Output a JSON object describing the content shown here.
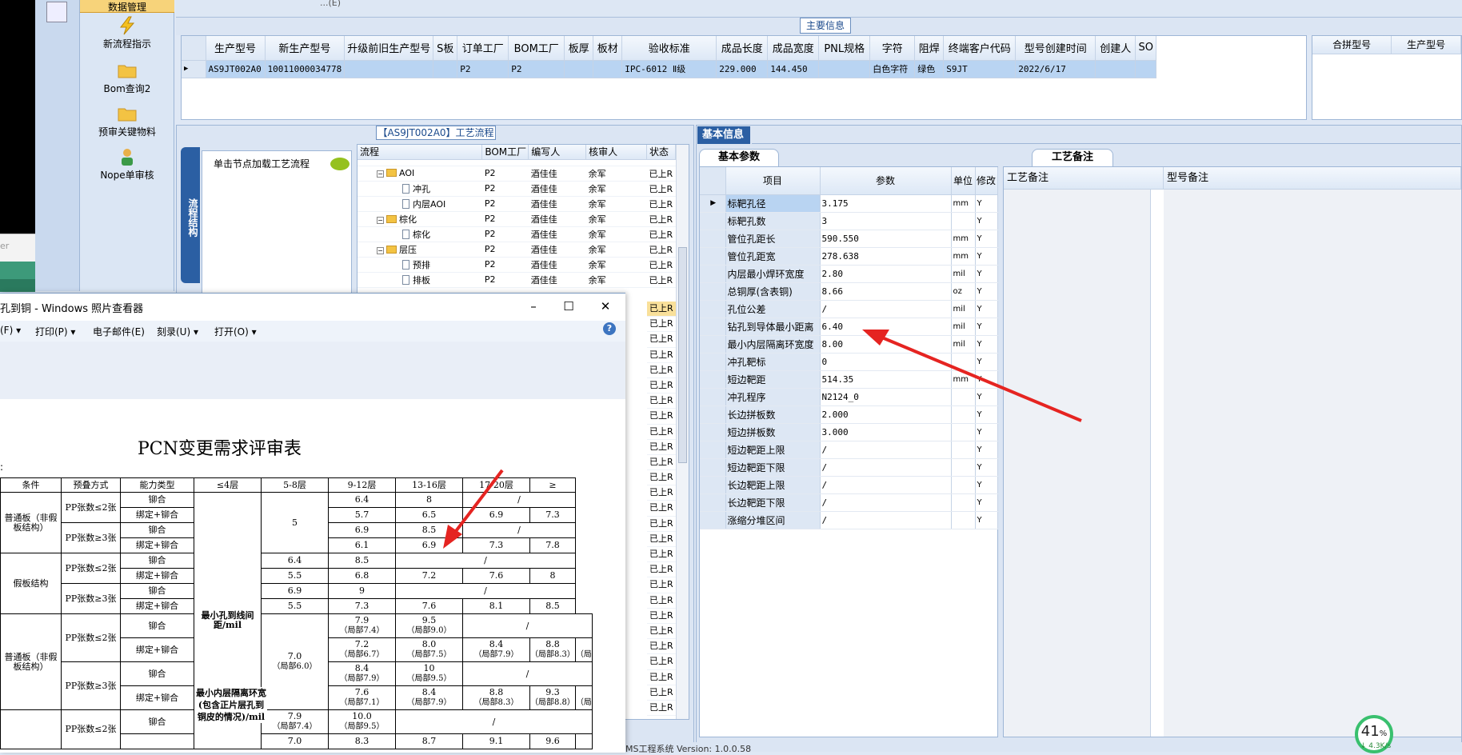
{
  "top_partial_text": "...(E)",
  "nav": {
    "header": "数据管理",
    "items": [
      {
        "label": "新流程指示"
      },
      {
        "label": "Bom查询2"
      },
      {
        "label": "预审关键物料"
      },
      {
        "label": "Nope单审核"
      }
    ]
  },
  "left_pane": {
    "placeholder": "er"
  },
  "main_info": {
    "title": "主要信息",
    "columns": [
      "生产型号",
      "新生产型号",
      "升级前旧生产型号",
      "S板",
      "订单工厂",
      "BOM工厂",
      "板厚",
      "板材",
      "验收标准",
      "成品长度",
      "成品宽度",
      "PNL规格",
      "字符",
      "阻焊",
      "终端客户代码",
      "型号创建时间",
      "创建人",
      "SO"
    ],
    "row": [
      "AS9JT002A0",
      "10011000034778",
      "",
      "",
      "P2",
      "P2",
      "",
      "",
      "IPC-6012 Ⅱ级",
      "229.000",
      "144.450",
      "",
      "白色字符",
      "绿色",
      "S9JT",
      "2022/6/17",
      "",
      ""
    ]
  },
  "right_grid": {
    "columns": [
      "合拼型号",
      "生产型号"
    ]
  },
  "process": {
    "title": "【AS9JT002A0】工艺流程",
    "vertical_tab": "流程结构",
    "hint": "单击节点加载工艺流程",
    "columns": [
      "流程",
      "BOM工厂",
      "编写人",
      "核审人",
      "状态"
    ],
    "rows": [
      {
        "name": "",
        "bom": "",
        "writer": "",
        "reviewer": "",
        "status": ""
      },
      {
        "name": "AOI",
        "bom": "P2",
        "writer": "酒佳佳",
        "reviewer": "余军",
        "status": "已上R"
      },
      {
        "name": "冲孔",
        "bom": "P2",
        "writer": "酒佳佳",
        "reviewer": "余军",
        "status": "已上R"
      },
      {
        "name": "内层AOI",
        "bom": "P2",
        "writer": "酒佳佳",
        "reviewer": "余军",
        "status": "已上R"
      },
      {
        "name": "棕化",
        "bom": "P2",
        "writer": "酒佳佳",
        "reviewer": "余军",
        "status": "已上R"
      },
      {
        "name": "棕化",
        "bom": "P2",
        "writer": "酒佳佳",
        "reviewer": "余军",
        "status": "已上R"
      },
      {
        "name": "层压",
        "bom": "P2",
        "writer": "酒佳佳",
        "reviewer": "余军",
        "status": "已上R"
      },
      {
        "name": "预排",
        "bom": "P2",
        "writer": "酒佳佳",
        "reviewer": "余军",
        "status": "已上R"
      },
      {
        "name": "排板",
        "bom": "P2",
        "writer": "酒佳佳",
        "reviewer": "余军",
        "status": "已上R"
      }
    ],
    "status_tail": "已上R"
  },
  "basic": {
    "tab": "基本信息",
    "param_tab": "基本参数",
    "remark_tab": "工艺备注",
    "param_columns": [
      "项目",
      "参数",
      "单位",
      "修改"
    ],
    "params": [
      {
        "item": "标靶孔径",
        "value": "3.175",
        "unit": "mm",
        "mod": "Y"
      },
      {
        "item": "标靶孔数",
        "value": "3",
        "unit": "",
        "mod": "Y"
      },
      {
        "item": "管位孔距长",
        "value": "590.550",
        "unit": "mm",
        "mod": "Y"
      },
      {
        "item": "管位孔距宽",
        "value": "278.638",
        "unit": "mm",
        "mod": "Y"
      },
      {
        "item": "内层最小焊环宽度",
        "value": "2.80",
        "unit": "mil",
        "mod": "Y"
      },
      {
        "item": "总铜厚(含表铜)",
        "value": "8.66",
        "unit": "oz",
        "mod": "Y"
      },
      {
        "item": "孔位公差",
        "value": "/",
        "unit": "mil",
        "mod": "Y"
      },
      {
        "item": "钻孔到导体最小距离",
        "value": "6.40",
        "unit": "mil",
        "mod": "Y"
      },
      {
        "item": "最小内层隔离环宽度",
        "value": "8.00",
        "unit": "mil",
        "mod": "Y"
      },
      {
        "item": "冲孔靶标",
        "value": "0",
        "unit": "",
        "mod": "Y"
      },
      {
        "item": "短边靶距",
        "value": "514.35",
        "unit": "mm",
        "mod": "Y"
      },
      {
        "item": "冲孔程序",
        "value": "N2124_0",
        "unit": "",
        "mod": "Y"
      },
      {
        "item": "长边拼板数",
        "value": "2.000",
        "unit": "",
        "mod": "Y"
      },
      {
        "item": "短边拼板数",
        "value": "3.000",
        "unit": "",
        "mod": "Y"
      },
      {
        "item": "短边靶距上限",
        "value": "/",
        "unit": "",
        "mod": "Y"
      },
      {
        "item": "短边靶距下限",
        "value": "/",
        "unit": "",
        "mod": "Y"
      },
      {
        "item": "长边靶距上限",
        "value": "/",
        "unit": "",
        "mod": "Y"
      },
      {
        "item": "长边靶距下限",
        "value": "/",
        "unit": "",
        "mod": "Y"
      },
      {
        "item": "涨缩分堆区间",
        "value": "/",
        "unit": "",
        "mod": "Y"
      }
    ],
    "remark_columns": [
      "工艺备注",
      "型号备注"
    ]
  },
  "status_bar": "MS工程系统  Version: 1.0.0.58",
  "net_widget": {
    "percent": "41",
    "unit": "%",
    "speed": "↓ 4.3K/s"
  },
  "viewer": {
    "title": "孔到铜 - Windows 照片查看器",
    "menu": [
      "(F) ▾",
      "打印(P) ▾",
      "电子邮件(E)",
      "刻录(U) ▾",
      "打开(O) ▾"
    ],
    "help": "?",
    "doc_title": "PCN变更需求评审表",
    "doc_colon": ":",
    "table": {
      "headers": [
        "条件",
        "预叠方式",
        "能力类型",
        "≤4层",
        "5-8层",
        "9-12层",
        "13-16层",
        "17-20层",
        "≥"
      ],
      "groups": {
        "normal": "普通板（非假板结构）",
        "fake": "假板结构",
        "pp_le2": "PP张数≤2张",
        "pp_ge3": "PP张数≥3张"
      },
      "stack": {
        "rivet": "铆合",
        "bind_rivet": "绑定+铆合"
      },
      "ability1": "最小孔到线间距/mil",
      "ability2": "最小内层隔离环宽(包含正片层孔到铜皮的情况)/mil",
      "r1": [
        "6.4",
        "8",
        "/"
      ],
      "r2": [
        "5.7",
        "6.5",
        "6.9",
        "7.3"
      ],
      "r3": [
        "6.9",
        "8.5",
        "/"
      ],
      "r4": [
        "6.1",
        "6.9",
        "7.3",
        "7.8"
      ],
      "le4_top": "5",
      "r5": [
        "6.4",
        "8.5",
        "/"
      ],
      "r6": [
        "5.5",
        "6.8",
        "7.2",
        "7.6",
        "8"
      ],
      "r7": [
        "6.9",
        "9",
        "/"
      ],
      "r8": [
        "5.5",
        "7.3",
        "7.6",
        "8.1",
        "8.5"
      ],
      "r9": [
        "7.9",
        "（局部7.4）",
        "9.5",
        "（局部9.0）",
        "/"
      ],
      "r10": [
        "7.2",
        "（局部6.7）",
        "8.0",
        "（局部7.5）",
        "8.4",
        "（局部7.9）",
        "8.8",
        "（局部8.3）",
        "（局"
      ],
      "le4_mid": "7.0",
      "le4_mid_sub": "（局部6.0）",
      "r11": [
        "8.4",
        "（局部7.9）",
        "10",
        "（局部9.5）",
        "/"
      ],
      "r12": [
        "7.6",
        "（局部7.1）",
        "8.4",
        "（局部7.9）",
        "8.8",
        "（局部8.3）",
        "9.3",
        "（局部8.8）",
        "（局"
      ],
      "r13": [
        "7.9",
        "（局部7.4）",
        "10.0",
        "（局部9.5）",
        "/"
      ],
      "r14": [
        "7.0",
        "8.3",
        "8.7",
        "9.1",
        "9.6"
      ]
    }
  },
  "colors": {
    "accent_blue": "#2b5fa3",
    "arrow_red": "#e52421",
    "select_yellow": "#f9e09a"
  }
}
